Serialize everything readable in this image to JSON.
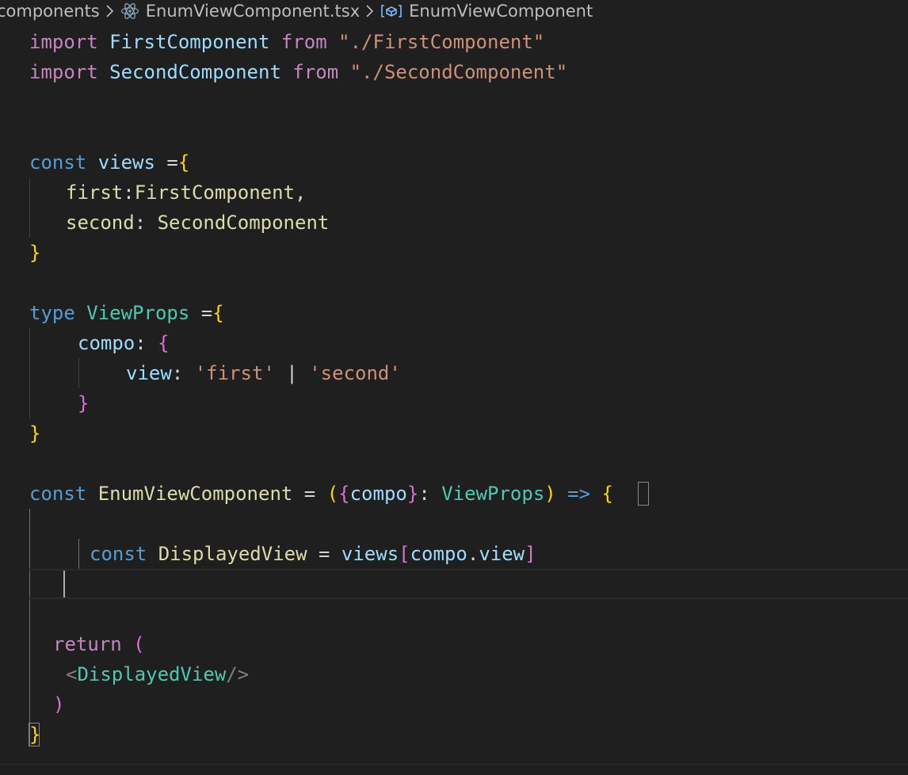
{
  "breadcrumb": {
    "folder": "components",
    "file": "EnumViewComponent.tsx",
    "symbol": "EnumViewComponent",
    "file_icon": "react-icon",
    "symbol_icon": "variable-icon",
    "separator_icon": "chevron-right-icon"
  },
  "code": {
    "l1": {
      "kw": "import",
      "name": "FirstComponent",
      "from": "from",
      "path": "\"./FirstComponent\""
    },
    "l2": {
      "kw": "import",
      "name": "SecondComponent",
      "from": "from",
      "path": "\"./SecondComponent\""
    },
    "l3": {
      "kw": "const",
      "name": "views",
      "op": " =",
      "open": "{"
    },
    "l4": {
      "key": "first",
      "colon": ":",
      "val": "FirstComponent",
      "comma": ","
    },
    "l5": {
      "key": "second",
      "colon": ": ",
      "val": "SecondComponent"
    },
    "l6": {
      "close": "}"
    },
    "l7": {
      "kw": "type",
      "name": "ViewProps",
      "op": " =",
      "open": "{"
    },
    "l8": {
      "key": "compo",
      "colon": ": ",
      "open": "{"
    },
    "l9": {
      "key": "view",
      "colon": ": ",
      "s1": "'first'",
      "bar": " | ",
      "s2": "'second'"
    },
    "l10": {
      "close": "}"
    },
    "l11": {
      "close": "}"
    },
    "l12": {
      "kw": "const",
      "name": "EnumViewComponent",
      "eq": " = ",
      "p1": "(",
      "b1": "{",
      "arg": "compo",
      "b2": "}",
      "colon": ": ",
      "type": "ViewProps",
      "p2": ")",
      "arrow": " => ",
      "open": "{"
    },
    "l13": {
      "kw": "const",
      "name": "DisplayedView",
      "eq": " = ",
      "obj": "views",
      "lb": "[",
      "a": "compo",
      "dot": ".",
      "b": "view",
      "rb": "]"
    },
    "l14": {
      "kw": "return",
      "paren": "("
    },
    "l15": {
      "lt": "<",
      "tag": "DisplayedView",
      "end": "/>"
    },
    "l16": {
      "paren": ")"
    },
    "l17": {
      "close": "}"
    }
  },
  "colors": {
    "background": "#1f1f1f",
    "keyword": "#569cd6",
    "control": "#c586c0",
    "variable": "#9cdcfe",
    "string": "#ce9178",
    "type": "#4ec9b0",
    "function": "#dcdcaa",
    "bracket1": "#ffd700",
    "bracket2": "#da70d6",
    "bracket3": "#179fff"
  }
}
